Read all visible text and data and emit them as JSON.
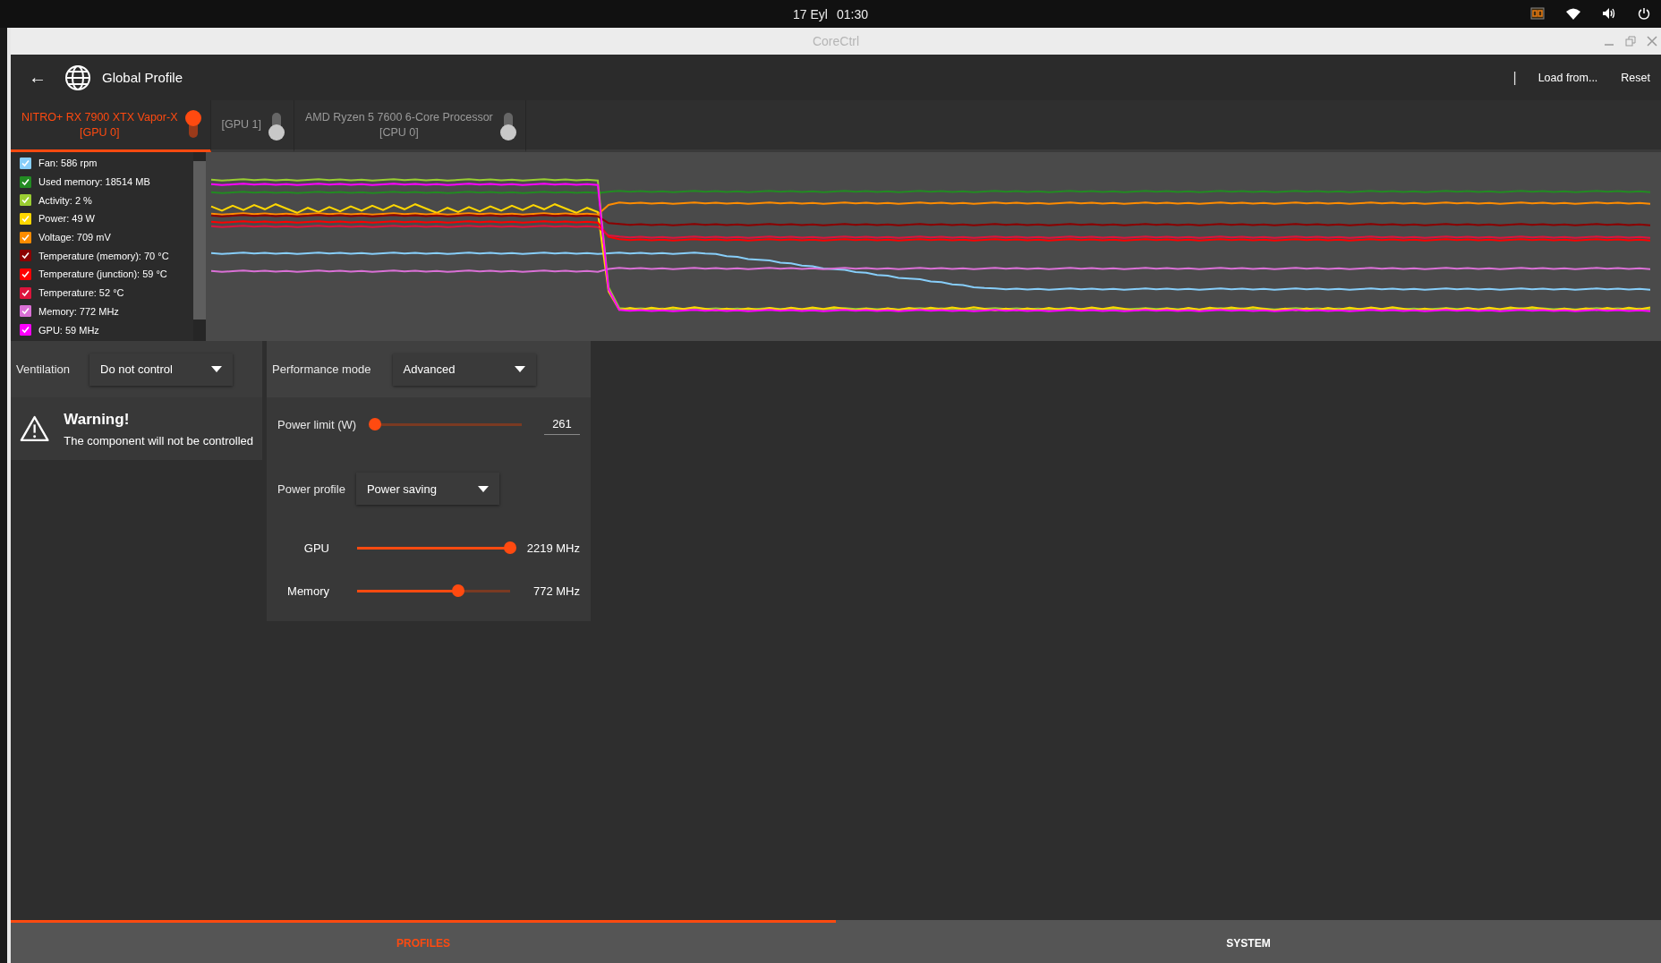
{
  "topbar": {
    "date": "17 Eyl",
    "time": "01:30"
  },
  "window": {
    "title": "CoreCtrl"
  },
  "header": {
    "back": "←",
    "title": "Global Profile",
    "separator": "|",
    "actions": [
      "Load from...",
      "Reset"
    ]
  },
  "devices": [
    {
      "name": "NITRO+ RX 7900 XTX Vapor-X",
      "id": "[GPU 0]",
      "selected": true,
      "enabled": true
    },
    {
      "id": "[GPU 1]",
      "selected": false,
      "enabled": false
    },
    {
      "name": "AMD Ryzen 5 7600 6-Core Processor",
      "id": "[CPU 0]",
      "selected": false,
      "enabled": false
    }
  ],
  "sensors": [
    {
      "label": "Fan: 586 rpm",
      "checked": true,
      "color": "#87cefa"
    },
    {
      "label": "Used memory: 18514  MB",
      "checked": true,
      "color": "#228b22"
    },
    {
      "label": "Activity: 2 %",
      "checked": true,
      "color": "#9acd32"
    },
    {
      "label": "Power: 49 W",
      "checked": true,
      "color": "#ffd700"
    },
    {
      "label": "Voltage: 709 mV",
      "checked": true,
      "color": "#ff8c00"
    },
    {
      "label": "Temperature (memory): 70 °C",
      "checked": true,
      "color": "#8b0000"
    },
    {
      "label": "Temperature (junction): 59 °C",
      "checked": true,
      "color": "#ff0000"
    },
    {
      "label": "Temperature: 52 °C",
      "checked": true,
      "color": "#dc143c"
    },
    {
      "label": "Memory: 772 MHz",
      "checked": true,
      "color": "#da70d6"
    },
    {
      "label": "GPU: 59 MHz",
      "checked": true,
      "color": "#ff00ff"
    }
  ],
  "ventilation": {
    "label": "Ventilation",
    "value": "Do not control"
  },
  "warning": {
    "title": "Warning!",
    "text": "The component will not be controlled"
  },
  "performance": {
    "label": "Performance mode",
    "value": "Advanced",
    "power_limit": {
      "label": "Power limit (W)",
      "level": 0,
      "value": "261"
    },
    "power_profile": {
      "label": "Power profile",
      "value": "Power saving"
    },
    "clocks": [
      {
        "label": "GPU",
        "level": 1,
        "reading": "2219 MHz"
      },
      {
        "label": "Memory",
        "level": 0.66,
        "reading": "772 MHz"
      }
    ]
  },
  "bottom_tabs": [
    {
      "label": "PROFILES",
      "selected": true
    },
    {
      "label": "SYSTEM",
      "selected": false
    }
  ]
}
